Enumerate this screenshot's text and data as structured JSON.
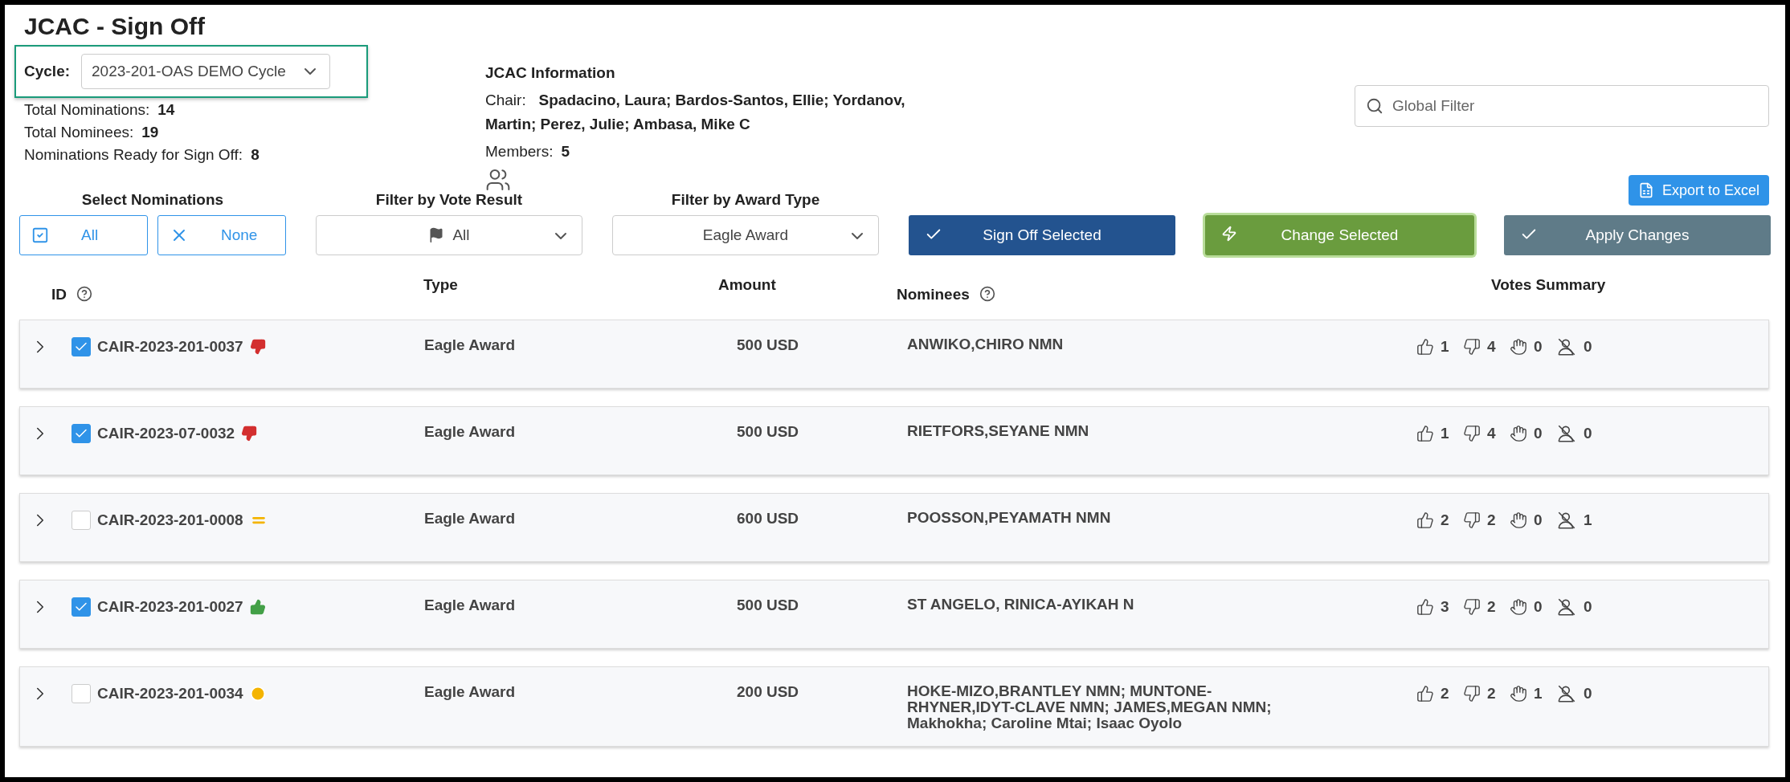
{
  "title": "JCAC - Sign Off",
  "cycle": {
    "label": "Cycle:",
    "value": "2023-201-OAS DEMO Cycle"
  },
  "totals": [
    {
      "label": "Total Nominations:",
      "value": "14"
    },
    {
      "label": "Total Nominees:",
      "value": "19"
    },
    {
      "label": "Nominations Ready for Sign Off:",
      "value": "8"
    }
  ],
  "jcac_info": {
    "heading": "JCAC Information",
    "chair_label": "Chair:",
    "chair_value": "Spadacino, Laura; Bardos-Santos, Ellie; Yordanov, Martin; Perez, Julie; Ambasa, Mike C",
    "members_label": "Members:",
    "members_value": "5"
  },
  "search": {
    "placeholder": "Global Filter"
  },
  "export_button": "Export to Excel",
  "select_nominations": {
    "label": "Select Nominations",
    "all": "All",
    "none": "None"
  },
  "vote_filter": {
    "label": "Filter by Vote Result",
    "value": "All"
  },
  "award_filter": {
    "label": "Filter by Award Type",
    "value": "Eagle Award"
  },
  "actions": [
    {
      "label": "Sign Off Selected",
      "kind": "signoff"
    },
    {
      "label": "Change Selected",
      "kind": "change"
    },
    {
      "label": "Apply Changes",
      "kind": "apply"
    }
  ],
  "columns": {
    "id": "ID",
    "type": "Type",
    "amount": "Amount",
    "nominees": "Nominees",
    "votes": "Votes Summary"
  },
  "rows": [
    {
      "id": "CAIR-2023-201-0037",
      "checked": true,
      "kind": "rejected",
      "type": "Eagle Award",
      "amount": "500 USD",
      "nominees": "ANWIKO,CHIRO NMN",
      "votes": [
        "1",
        "4",
        "0",
        "0"
      ]
    },
    {
      "id": "CAIR-2023-07-0032",
      "checked": true,
      "kind": "rejected",
      "type": "Eagle Award",
      "amount": "500 USD",
      "nominees": "RIETFORS,SEYANE NMN",
      "votes": [
        "1",
        "4",
        "0",
        "0"
      ]
    },
    {
      "id": "CAIR-2023-201-0008",
      "checked": false,
      "kind": "tie",
      "type": "Eagle Award",
      "amount": "600 USD",
      "nominees": "POOSSON,PEYAMATH NMN",
      "votes": [
        "2",
        "2",
        "0",
        "1"
      ]
    },
    {
      "id": "CAIR-2023-201-0027",
      "checked": true,
      "kind": "approved",
      "type": "Eagle Award",
      "amount": "500 USD",
      "nominees": "ST ANGELO, RINICA-AYIKAH N",
      "votes": [
        "3",
        "2",
        "0",
        "0"
      ]
    },
    {
      "id": "CAIR-2023-201-0034",
      "checked": false,
      "kind": "pending",
      "type": "Eagle Award",
      "amount": "200 USD",
      "nominees": "HOKE-MIZO,BRANTLEY NMN; MUNTONE-RHYNER,IDYT-CLAVE NMN; JAMES,MEGAN NMN; Makhokha; Caroline Mtai; Isaac Oyolo",
      "votes": [
        "2",
        "2",
        "1",
        "0"
      ]
    }
  ]
}
